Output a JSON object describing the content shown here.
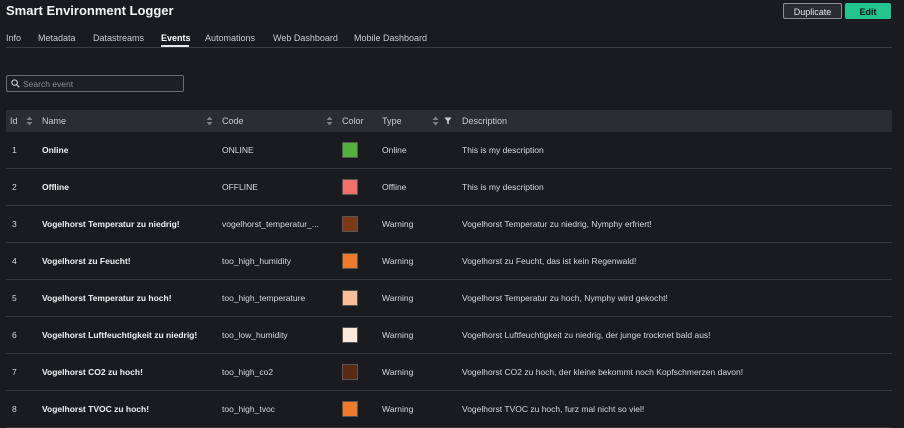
{
  "app": {
    "title": "Smart Environment Logger"
  },
  "buttons": {
    "duplicate": "Duplicate",
    "edit": "Edit"
  },
  "tabs": [
    "Info",
    "Metadata",
    "Datastreams",
    "Events",
    "Automations",
    "Web Dashboard",
    "Mobile Dashboard"
  ],
  "active_tab": "Events",
  "search": {
    "placeholder": "Search event",
    "value": ""
  },
  "table": {
    "columns": {
      "id": "Id",
      "name": "Name",
      "code": "Code",
      "color": "Color",
      "type": "Type",
      "description": "Description"
    },
    "rows": [
      {
        "id": "1",
        "name": "Online",
        "code": "ONLINE",
        "color": "#53b03c",
        "type": "Online",
        "description": "This is my description"
      },
      {
        "id": "2",
        "name": "Offline",
        "code": "OFFLINE",
        "color": "#f36f6a",
        "type": "Offline",
        "description": "This is my description"
      },
      {
        "id": "3",
        "name": "Vogelhorst Temperatur zu niedrig!",
        "code": "vogelhorst_temperatur_...",
        "color": "#7a3a16",
        "type": "Warning",
        "description": "Vogelhorst Temperatur zu niedrig, Nymphy erfriert!"
      },
      {
        "id": "4",
        "name": "Vogelhorst zu Feucht!",
        "code": "too_high_humidity",
        "color": "#f07a2c",
        "type": "Warning",
        "description": "Vogelhorst zu Feucht, das ist kein Regenwald!"
      },
      {
        "id": "5",
        "name": "Vogelhorst Temperatur zu hoch!",
        "code": "too_high_temperature",
        "color": "#f8be97",
        "type": "Warning",
        "description": "Vogelhorst Temperatur zu hoch, Nymphy wird gekocht!"
      },
      {
        "id": "6",
        "name": "Vogelhorst Luftfeuchtigkeit zu niedrig!",
        "code": "too_low_humidity",
        "color": "#fde8dc",
        "type": "Warning",
        "description": "Vogelhorst Luftfeuchtigkeit zu niedrig, der junge trocknet bald aus!"
      },
      {
        "id": "7",
        "name": "Vogelhorst CO2 zu hoch!",
        "code": "too_high_co2",
        "color": "#5a2b14",
        "type": "Warning",
        "description": "Vogelhorst CO2 zu hoch, der kleine bekommt noch Kopfschmerzen davon!"
      },
      {
        "id": "8",
        "name": "Vogelhorst TVOC zu hoch!",
        "code": "too_high_tvoc",
        "color": "#f07a2c",
        "type": "Warning",
        "description": "Vogelhorst TVOC zu hoch, furz mal nicht so viel!"
      }
    ]
  },
  "icons": {
    "search": "search-icon",
    "sort": "sort-icon",
    "filter": "filter-icon"
  }
}
